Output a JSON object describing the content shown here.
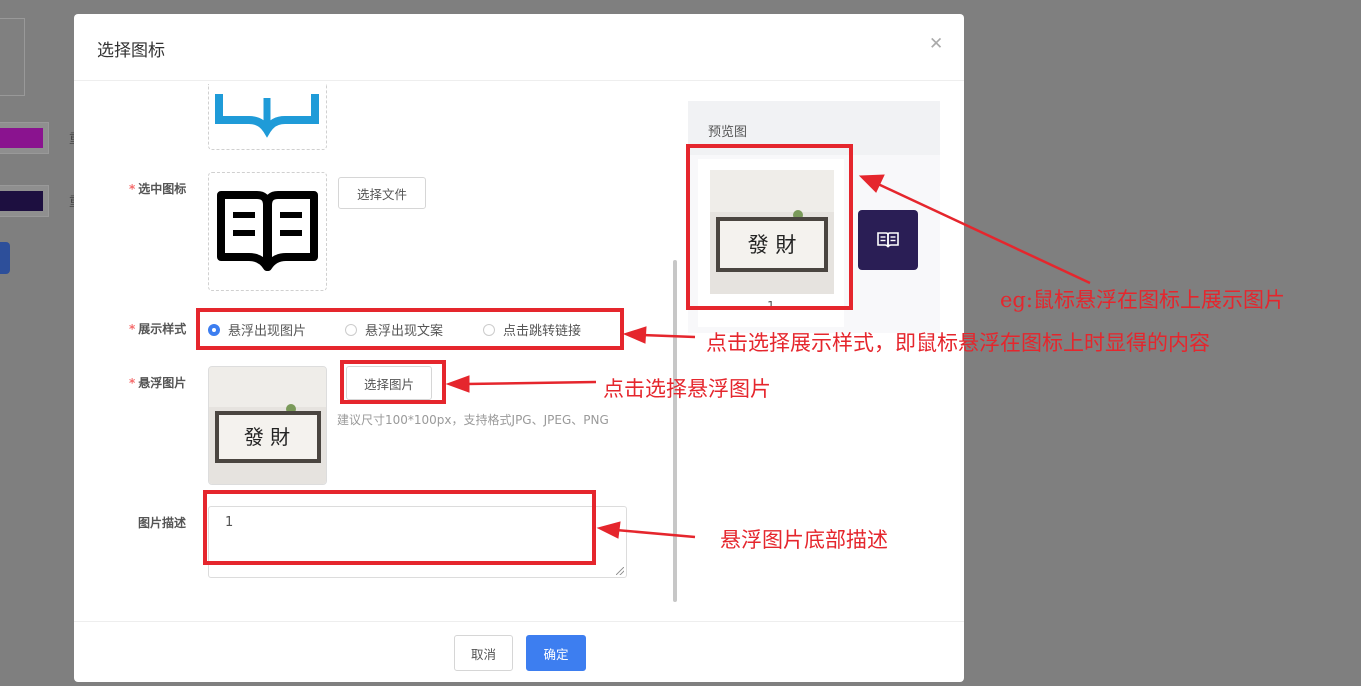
{
  "background": {
    "fragments": [
      {
        "char": "重",
        "color": "#8a138f"
      },
      {
        "char": "重",
        "color": "#1d0f40"
      }
    ]
  },
  "dialog": {
    "title": "选择图标",
    "close_icon": "close-icon",
    "form": {
      "selected_icon": {
        "label": "选中图标",
        "button": "选择文件",
        "icon": "open-book-icon"
      },
      "display_style": {
        "label": "展示样式",
        "options": [
          "悬浮出现图片",
          "悬浮出现文案",
          "点击跳转链接"
        ],
        "selected_index": 0
      },
      "hover_image": {
        "label": "悬浮图片",
        "button": "选择图片",
        "hint": "建议尺寸100*100px，支持格式JPG、JPEG、PNG",
        "image_text": "發 財"
      },
      "image_desc": {
        "label": "图片描述",
        "value": "1"
      }
    },
    "preview": {
      "title": "预览图",
      "caption": "1",
      "image_text": "發 財",
      "icon": "book-icon"
    },
    "footer": {
      "cancel": "取消",
      "confirm": "确定"
    }
  },
  "annotations": {
    "hover_preview": "eg:鼠标悬浮在图标上展示图片",
    "display_style": "点击选择展示样式，即鼠标悬浮在图标上时显得的内容",
    "select_image": "点击选择悬浮图片",
    "description": "悬浮图片底部描述"
  },
  "colors": {
    "primary": "#3d7ef0",
    "annotation_red": "#e5262d",
    "required_star": "#f56c6c",
    "preview_icon_bg": "#2a1e55",
    "bg_swatch_1": "#8a138f",
    "bg_swatch_2": "#1d0f40"
  }
}
